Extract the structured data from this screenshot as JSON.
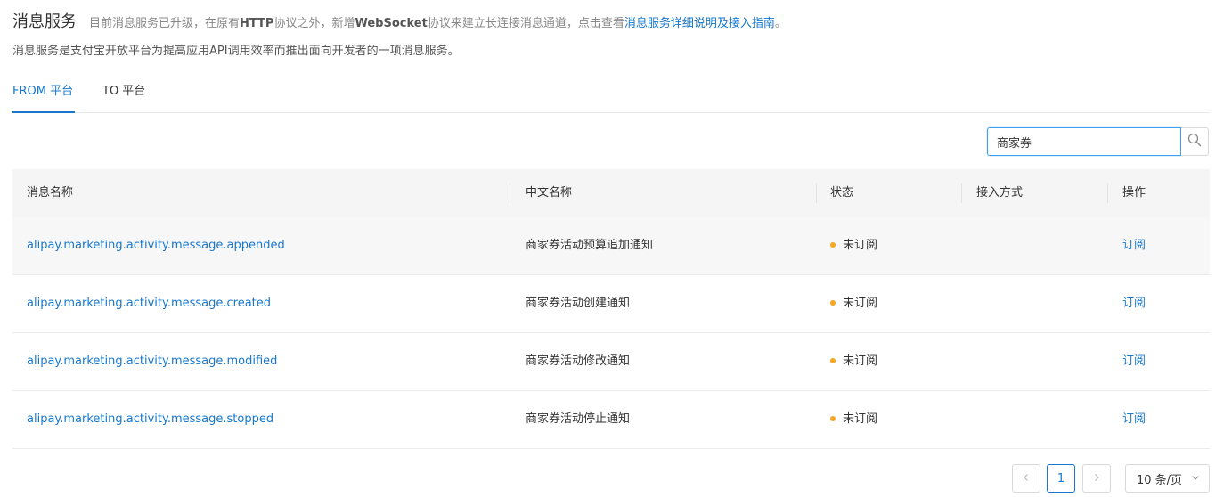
{
  "header": {
    "title": "消息服务",
    "notice_prefix": "目前消息服务已升级，在原有",
    "notice_http": "HTTP",
    "notice_mid": "协议之外，新增",
    "notice_ws": "WebSocket",
    "notice_suffix": "协议来建立长连接消息通道，点击查看",
    "guide_link": "消息服务详细说明及接入指南",
    "notice_end": "。"
  },
  "description": "消息服务是支付宝开放平台为提高应用API调用效率而推出面向开发者的一项消息服务。",
  "tabs": [
    {
      "label": "FROM 平台",
      "active": true
    },
    {
      "label": "TO 平台",
      "active": false
    }
  ],
  "search": {
    "value": "商家券",
    "icon": "search-icon"
  },
  "table": {
    "columns": [
      "消息名称",
      "中文名称",
      "状态",
      "接入方式",
      "操作"
    ],
    "rows": [
      {
        "name": "alipay.marketing.activity.message.appended",
        "cn_name": "商家券活动预算追加通知",
        "status": "未订阅",
        "access": "",
        "action": "订阅"
      },
      {
        "name": "alipay.marketing.activity.message.created",
        "cn_name": "商家券活动创建通知",
        "status": "未订阅",
        "access": "",
        "action": "订阅"
      },
      {
        "name": "alipay.marketing.activity.message.modified",
        "cn_name": "商家券活动修改通知",
        "status": "未订阅",
        "access": "",
        "action": "订阅"
      },
      {
        "name": "alipay.marketing.activity.message.stopped",
        "cn_name": "商家券活动停止通知",
        "status": "未订阅",
        "access": "",
        "action": "订阅"
      }
    ]
  },
  "pagination": {
    "current_page": "1",
    "page_size_label": "10 条/页"
  },
  "colors": {
    "accent": "#1677cc",
    "status_dot": "#f5a623"
  }
}
